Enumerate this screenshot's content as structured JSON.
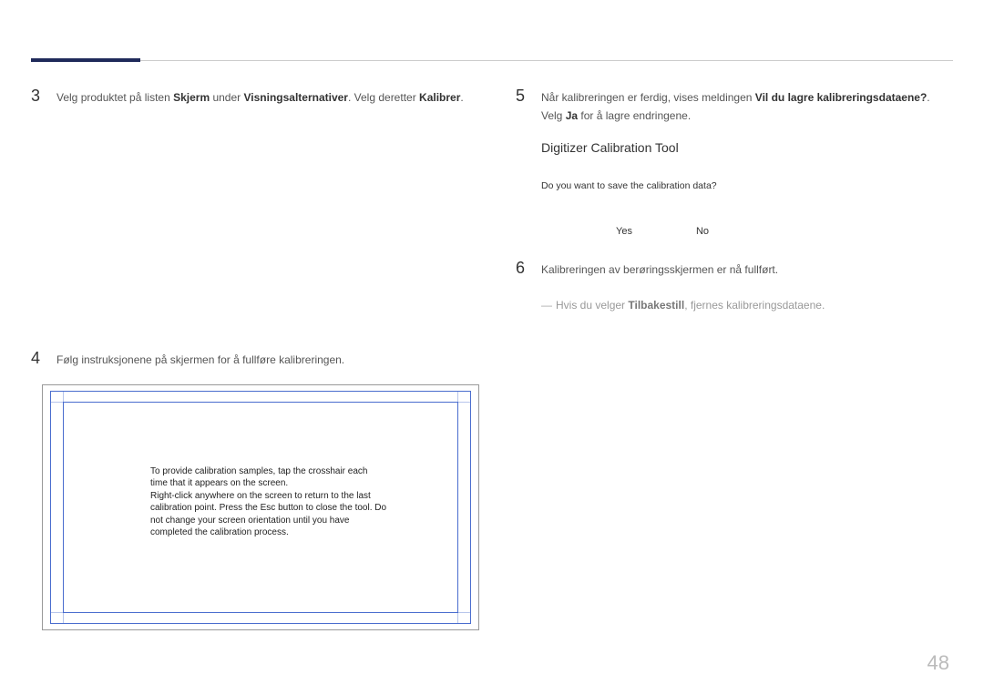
{
  "page_number": "48",
  "left": {
    "step3": {
      "num": "3",
      "text_pre": "Velg produktet på listen ",
      "b1": "Skjerm",
      "mid1": " under ",
      "b2": "Visningsalternativer",
      "mid2": ". Velg deretter ",
      "b3": "Kalibrer",
      "post": "."
    },
    "step4": {
      "num": "4",
      "text": "Følg instruksjonene på skjermen for å fullføre kalibreringen."
    },
    "calib_msg": "To provide calibration samples, tap the crosshair each time that it appears on the screen.\nRight-click anywhere on the screen to return to the last calibration point. Press the Esc button to close the tool. Do not change your screen orientation until you have completed the calibration process."
  },
  "right": {
    "step5": {
      "num": "5",
      "pre": "Når kalibreringen er ferdig, vises meldingen ",
      "b1": "Vil du lagre kalibreringsdataene?",
      "mid": ". Velg ",
      "b2": "Ja",
      "post": " for å lagre endringene."
    },
    "dialog": {
      "title": "Digitizer Calibration Tool",
      "question": "Do you want to save the calibration data?",
      "yes": "Yes",
      "no": "No"
    },
    "step6": {
      "num": "6",
      "text": "Kalibreringen av berøringsskjermen er nå fullført."
    },
    "note": {
      "dash": "―",
      "pre": "Hvis du velger ",
      "b": "Tilbakestill",
      "post": ", fjernes kalibreringsdataene."
    }
  }
}
